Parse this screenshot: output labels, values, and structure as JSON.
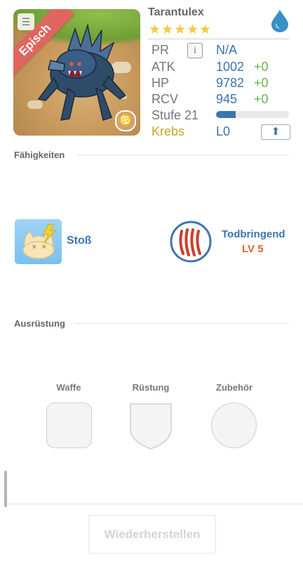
{
  "monster": {
    "name": "Tarantulex",
    "rarity": "Episch",
    "stars": "★★★★★",
    "star_count": 5,
    "element_icon": "water-drop-icon",
    "zodiac_symbol": "♋"
  },
  "stats": {
    "pr": {
      "label": "PR",
      "value": "N/A"
    },
    "atk": {
      "label": "ATK",
      "value": "1002",
      "bonus": "+0"
    },
    "hp": {
      "label": "HP",
      "value": "9782",
      "bonus": "+0"
    },
    "rcv": {
      "label": "RCV",
      "value": "945",
      "bonus": "+0"
    },
    "level": {
      "label": "Stufe 21",
      "progress": 0.27
    },
    "zodiac": {
      "label": "Krebs",
      "rank": "L0"
    }
  },
  "skills": {
    "title": "Fähigkeiten",
    "active": {
      "name": "Stoß"
    },
    "passive": {
      "name": "Todbringend",
      "level": "LV 5"
    }
  },
  "equipment": {
    "title": "Ausrüstung",
    "slots": [
      {
        "label": "Waffe"
      },
      {
        "label": "Rüstung"
      },
      {
        "label": "Zubehör"
      }
    ]
  },
  "actions": {
    "restore_label": "Wiederherstellen"
  },
  "colors": {
    "accent_blue": "#3d74b0",
    "bonus_green": "#69b24b",
    "rarity_red": "#e0655f",
    "zodiac_gold": "#c7a628",
    "star_yellow": "#f6c845",
    "level_orange": "#e06033"
  }
}
